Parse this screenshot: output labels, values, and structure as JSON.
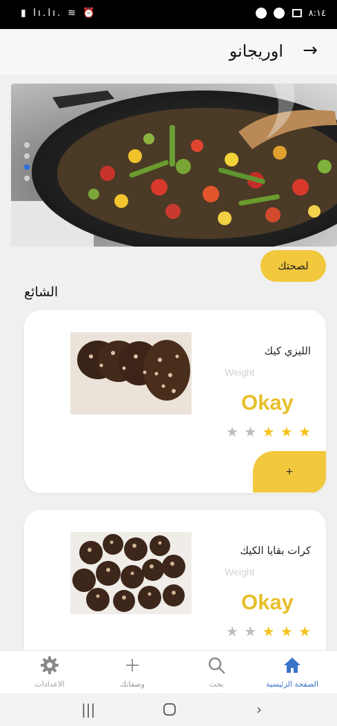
{
  "status_bar": {
    "time": "٨:١٤"
  },
  "appbar": {
    "title": "اوريجانو",
    "back_icon": "arrow-right-icon"
  },
  "banner": {
    "slides_count": 4,
    "active_slide": 3
  },
  "chip": {
    "label": "لصحتك"
  },
  "section": {
    "title": "الشائع"
  },
  "recipes": [
    {
      "name": "الليزي كيك",
      "weight_label": "Weight",
      "rating_text": "Okay",
      "rating": 3,
      "max_rating": 5,
      "add_label": "+"
    },
    {
      "name": "كرات بقايا الكيك",
      "weight_label": "Weight",
      "rating_text": "Okay",
      "rating": 3,
      "max_rating": 5,
      "add_label": "+"
    }
  ],
  "bottom_nav": {
    "items": [
      {
        "label": "الصفحة الرئيسية",
        "icon": "home-icon",
        "active": true
      },
      {
        "label": "بحث",
        "icon": "search-icon",
        "active": false
      },
      {
        "label": "وصفاتك",
        "icon": "plus-icon",
        "active": false
      },
      {
        "label": "الاعدادات",
        "icon": "gear-icon",
        "active": false
      }
    ]
  },
  "colors": {
    "accent": "#f2c83c",
    "okay": "#e7bf2b",
    "active_nav": "#3a73c8",
    "dot_active": "#2f6fe0"
  }
}
